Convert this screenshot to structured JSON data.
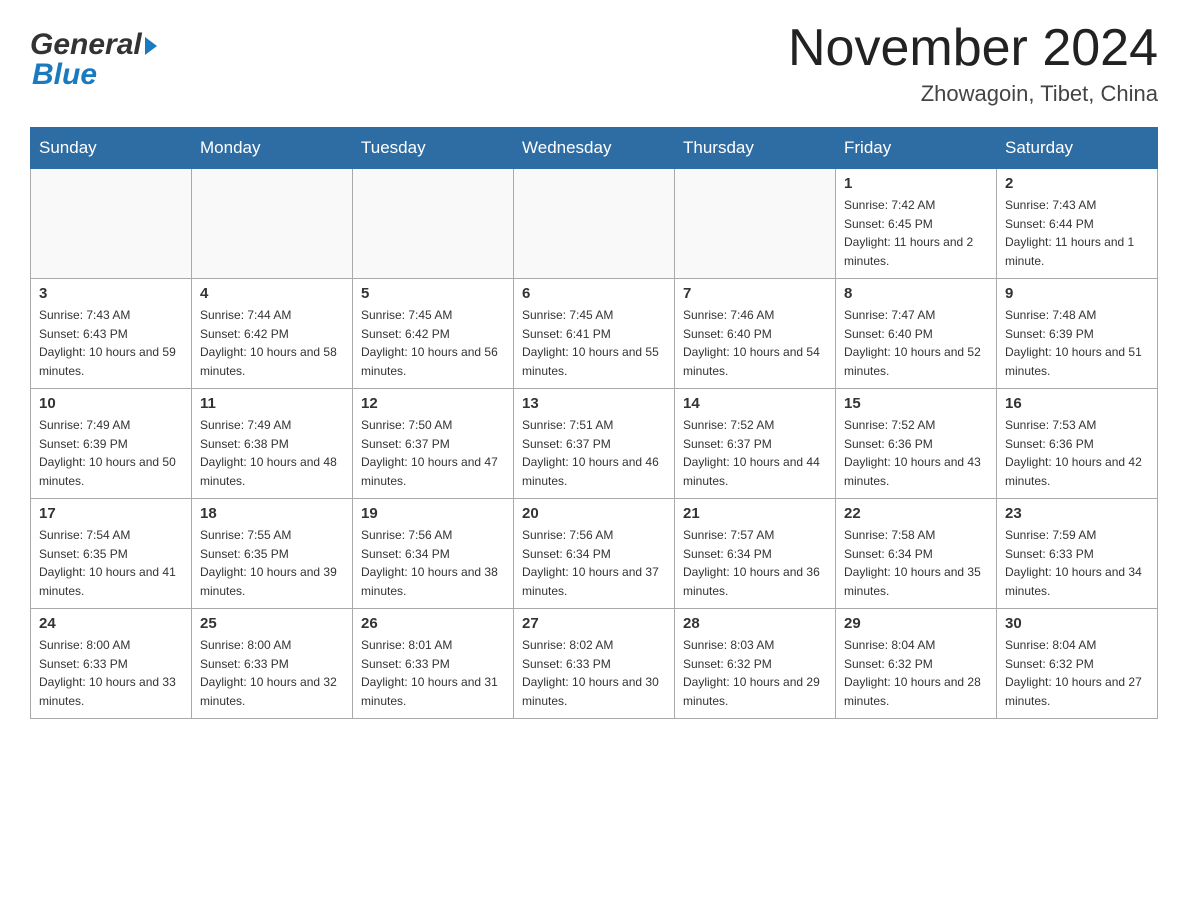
{
  "header": {
    "month_title": "November 2024",
    "location": "Zhowagoin, Tibet, China"
  },
  "weekdays": [
    "Sunday",
    "Monday",
    "Tuesday",
    "Wednesday",
    "Thursday",
    "Friday",
    "Saturday"
  ],
  "weeks": [
    [
      {
        "day": "",
        "info": ""
      },
      {
        "day": "",
        "info": ""
      },
      {
        "day": "",
        "info": ""
      },
      {
        "day": "",
        "info": ""
      },
      {
        "day": "",
        "info": ""
      },
      {
        "day": "1",
        "info": "Sunrise: 7:42 AM\nSunset: 6:45 PM\nDaylight: 11 hours and 2 minutes."
      },
      {
        "day": "2",
        "info": "Sunrise: 7:43 AM\nSunset: 6:44 PM\nDaylight: 11 hours and 1 minute."
      }
    ],
    [
      {
        "day": "3",
        "info": "Sunrise: 7:43 AM\nSunset: 6:43 PM\nDaylight: 10 hours and 59 minutes."
      },
      {
        "day": "4",
        "info": "Sunrise: 7:44 AM\nSunset: 6:42 PM\nDaylight: 10 hours and 58 minutes."
      },
      {
        "day": "5",
        "info": "Sunrise: 7:45 AM\nSunset: 6:42 PM\nDaylight: 10 hours and 56 minutes."
      },
      {
        "day": "6",
        "info": "Sunrise: 7:45 AM\nSunset: 6:41 PM\nDaylight: 10 hours and 55 minutes."
      },
      {
        "day": "7",
        "info": "Sunrise: 7:46 AM\nSunset: 6:40 PM\nDaylight: 10 hours and 54 minutes."
      },
      {
        "day": "8",
        "info": "Sunrise: 7:47 AM\nSunset: 6:40 PM\nDaylight: 10 hours and 52 minutes."
      },
      {
        "day": "9",
        "info": "Sunrise: 7:48 AM\nSunset: 6:39 PM\nDaylight: 10 hours and 51 minutes."
      }
    ],
    [
      {
        "day": "10",
        "info": "Sunrise: 7:49 AM\nSunset: 6:39 PM\nDaylight: 10 hours and 50 minutes."
      },
      {
        "day": "11",
        "info": "Sunrise: 7:49 AM\nSunset: 6:38 PM\nDaylight: 10 hours and 48 minutes."
      },
      {
        "day": "12",
        "info": "Sunrise: 7:50 AM\nSunset: 6:37 PM\nDaylight: 10 hours and 47 minutes."
      },
      {
        "day": "13",
        "info": "Sunrise: 7:51 AM\nSunset: 6:37 PM\nDaylight: 10 hours and 46 minutes."
      },
      {
        "day": "14",
        "info": "Sunrise: 7:52 AM\nSunset: 6:37 PM\nDaylight: 10 hours and 44 minutes."
      },
      {
        "day": "15",
        "info": "Sunrise: 7:52 AM\nSunset: 6:36 PM\nDaylight: 10 hours and 43 minutes."
      },
      {
        "day": "16",
        "info": "Sunrise: 7:53 AM\nSunset: 6:36 PM\nDaylight: 10 hours and 42 minutes."
      }
    ],
    [
      {
        "day": "17",
        "info": "Sunrise: 7:54 AM\nSunset: 6:35 PM\nDaylight: 10 hours and 41 minutes."
      },
      {
        "day": "18",
        "info": "Sunrise: 7:55 AM\nSunset: 6:35 PM\nDaylight: 10 hours and 39 minutes."
      },
      {
        "day": "19",
        "info": "Sunrise: 7:56 AM\nSunset: 6:34 PM\nDaylight: 10 hours and 38 minutes."
      },
      {
        "day": "20",
        "info": "Sunrise: 7:56 AM\nSunset: 6:34 PM\nDaylight: 10 hours and 37 minutes."
      },
      {
        "day": "21",
        "info": "Sunrise: 7:57 AM\nSunset: 6:34 PM\nDaylight: 10 hours and 36 minutes."
      },
      {
        "day": "22",
        "info": "Sunrise: 7:58 AM\nSunset: 6:34 PM\nDaylight: 10 hours and 35 minutes."
      },
      {
        "day": "23",
        "info": "Sunrise: 7:59 AM\nSunset: 6:33 PM\nDaylight: 10 hours and 34 minutes."
      }
    ],
    [
      {
        "day": "24",
        "info": "Sunrise: 8:00 AM\nSunset: 6:33 PM\nDaylight: 10 hours and 33 minutes."
      },
      {
        "day": "25",
        "info": "Sunrise: 8:00 AM\nSunset: 6:33 PM\nDaylight: 10 hours and 32 minutes."
      },
      {
        "day": "26",
        "info": "Sunrise: 8:01 AM\nSunset: 6:33 PM\nDaylight: 10 hours and 31 minutes."
      },
      {
        "day": "27",
        "info": "Sunrise: 8:02 AM\nSunset: 6:33 PM\nDaylight: 10 hours and 30 minutes."
      },
      {
        "day": "28",
        "info": "Sunrise: 8:03 AM\nSunset: 6:32 PM\nDaylight: 10 hours and 29 minutes."
      },
      {
        "day": "29",
        "info": "Sunrise: 8:04 AM\nSunset: 6:32 PM\nDaylight: 10 hours and 28 minutes."
      },
      {
        "day": "30",
        "info": "Sunrise: 8:04 AM\nSunset: 6:32 PM\nDaylight: 10 hours and 27 minutes."
      }
    ]
  ],
  "logo": {
    "general": "General",
    "blue": "Blue"
  }
}
